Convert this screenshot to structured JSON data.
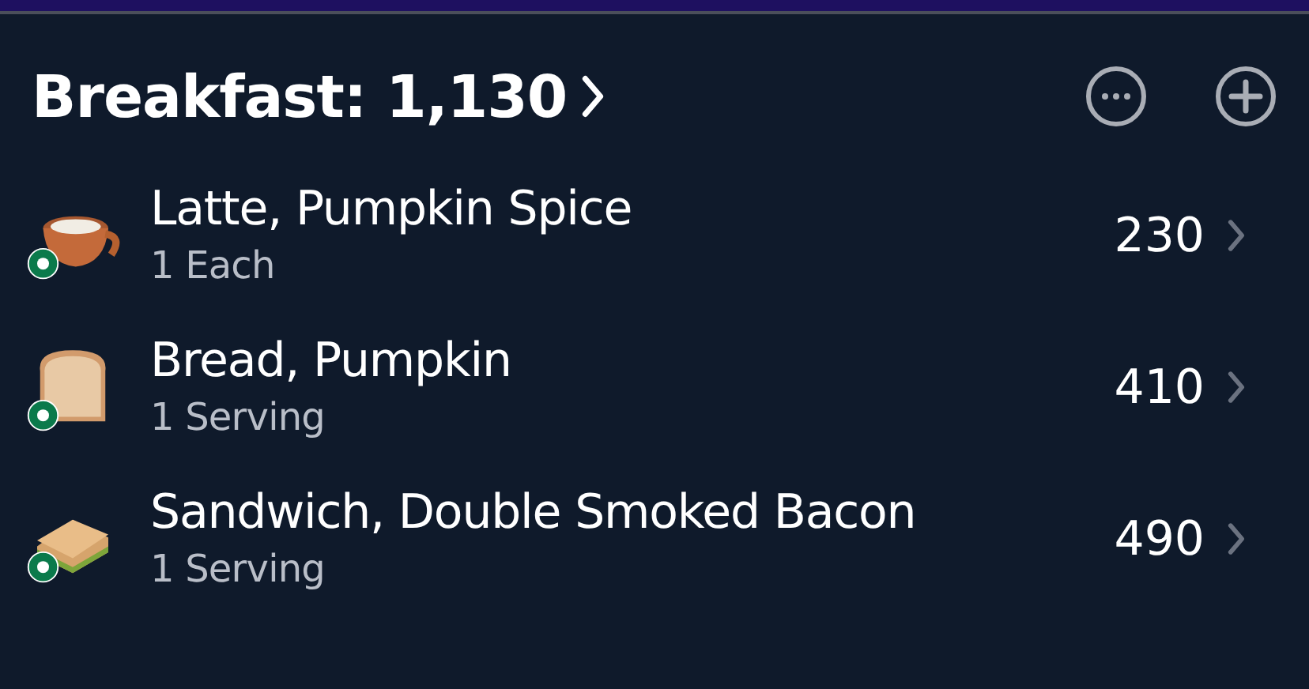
{
  "header": {
    "title": "Breakfast: 1,130"
  },
  "items": [
    {
      "name": "Latte, Pumpkin Spice",
      "serving": "1 Each",
      "calories": "230"
    },
    {
      "name": "Bread, Pumpkin",
      "serving": "1 Serving",
      "calories": "410"
    },
    {
      "name": "Sandwich, Double Smoked Bacon",
      "serving": "1 Serving",
      "calories": "490"
    }
  ]
}
